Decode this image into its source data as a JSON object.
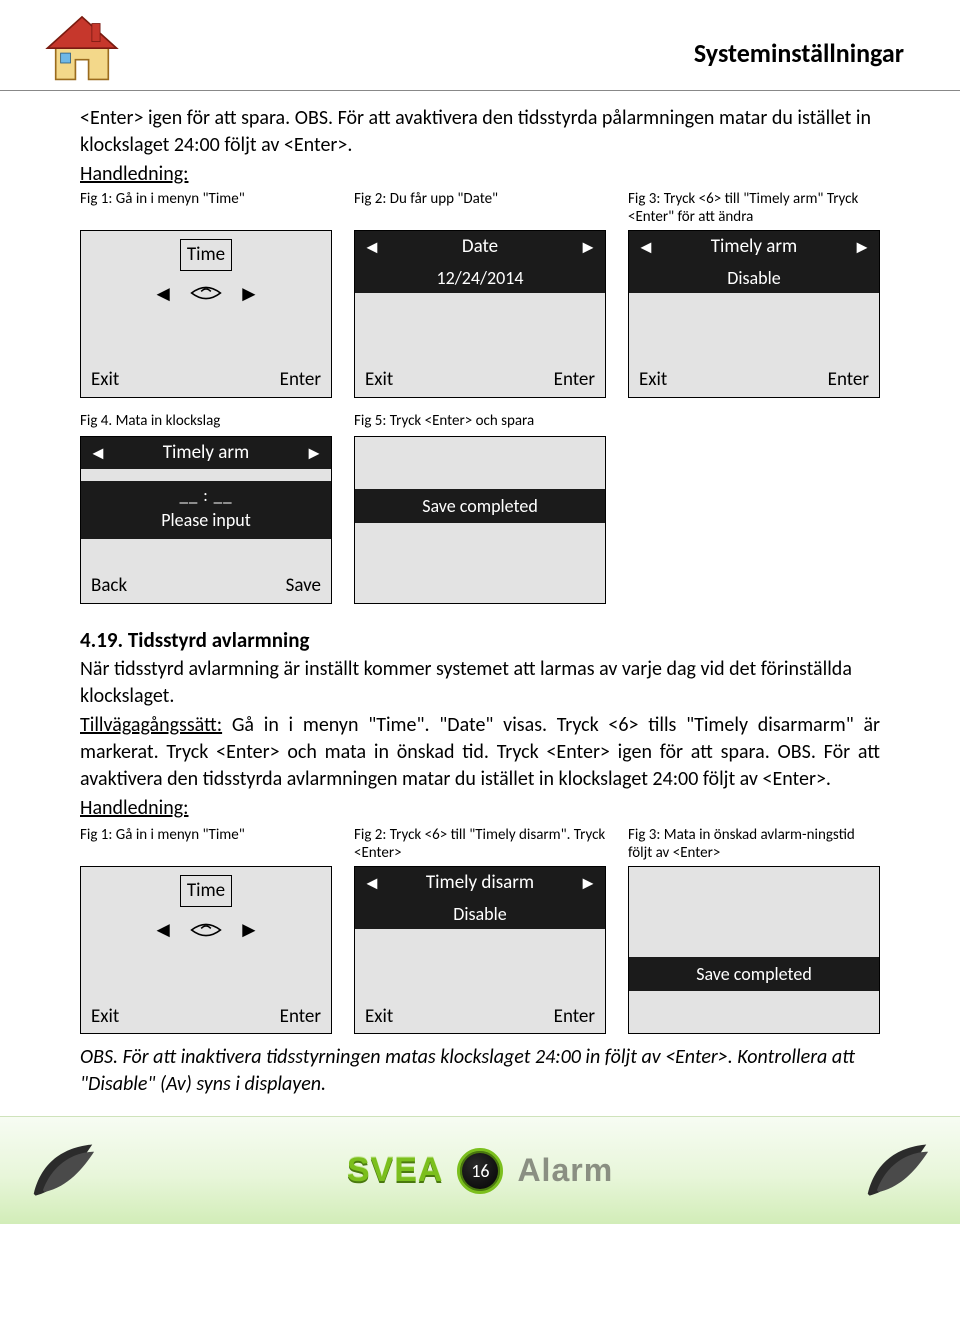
{
  "header": {
    "title": "Systeminställningar"
  },
  "intro": "<Enter> igen för att spara. OBS. För att avaktivera den tidsstyrda pålarmningen matar du istället in klockslaget 24:00 följt av <Enter>.",
  "handledning_label": "Handledning:",
  "fig_row_a": {
    "f1": {
      "caption": "Fig 1: Gå in i menyn \"Time\"",
      "title": "Time",
      "exit": "Exit",
      "enter": "Enter"
    },
    "f2": {
      "caption": "Fig 2: Du får upp \"Date\"",
      "arrow_left": "◄",
      "title": "Date",
      "arrow_right": "►",
      "value": "12/24/2014",
      "exit": "Exit",
      "enter": "Enter"
    },
    "f3": {
      "caption": "Fig 3: Tryck <6> till \"Timely arm\" Tryck <Enter\" för att ändra",
      "arrow_left": "◄",
      "title": "Timely arm",
      "arrow_right": "►",
      "value": "Disable",
      "exit": "Exit",
      "enter": "Enter"
    }
  },
  "fig_row_b": {
    "f4": {
      "caption": "Fig 4. Mata in klockslag",
      "arrow_left": "◄",
      "title": "Timely arm",
      "arrow_right": "►",
      "slots": "__ : __",
      "prompt": "Please input",
      "back": "Back",
      "save": "Save"
    },
    "f5": {
      "caption": "Fig 5: Tryck <Enter> och spara",
      "banner": "Save completed"
    }
  },
  "section419": {
    "heading": "4.19. Tidsstyrd avlarmning",
    "body": "När tidsstyrd avlarmning är inställt kommer systemet att larmas av varje dag vid det förinställda klockslaget.",
    "tillv_label": "Tillvägagångssätt:",
    "tillv_text": " Gå in i menyn \"Time\". \"Date\" visas. Tryck <6> tills \"Timely disarmarm\" är markerat. Tryck <Enter> och mata in önskad tid. Tryck <Enter> igen för att spara. OBS. För att avaktivera den tidsstyrda avlarmningen matar du istället in klockslaget 24:00 följt av <Enter>."
  },
  "fig_row_c": {
    "f1": {
      "caption": "Fig 1: Gå in i menyn \"Time\"",
      "title": "Time",
      "exit": "Exit",
      "enter": "Enter"
    },
    "f2": {
      "caption": "Fig 2: Tryck <6> till \"Timely disarm\". Tryck <Enter>",
      "arrow_left": "◄",
      "title": "Timely disarm",
      "arrow_right": "►",
      "value": "Disable",
      "exit": "Exit",
      "enter": "Enter"
    },
    "f3": {
      "caption": "Fig 3: Mata in önskad avlarm-ningstid följt av <Enter>",
      "banner": "Save completed"
    }
  },
  "obs_note": "OBS. För att inaktivera tidsstyrningen matas klockslaget 24:00 in följt av <Enter>. Kontrollera att \"Disable\" (Av) syns i displayen.",
  "footer": {
    "brand1": "SVEA",
    "page": "16",
    "brand2": "Alarm"
  },
  "glyphs": {
    "tri_left": "◄",
    "tri_right": "►"
  }
}
